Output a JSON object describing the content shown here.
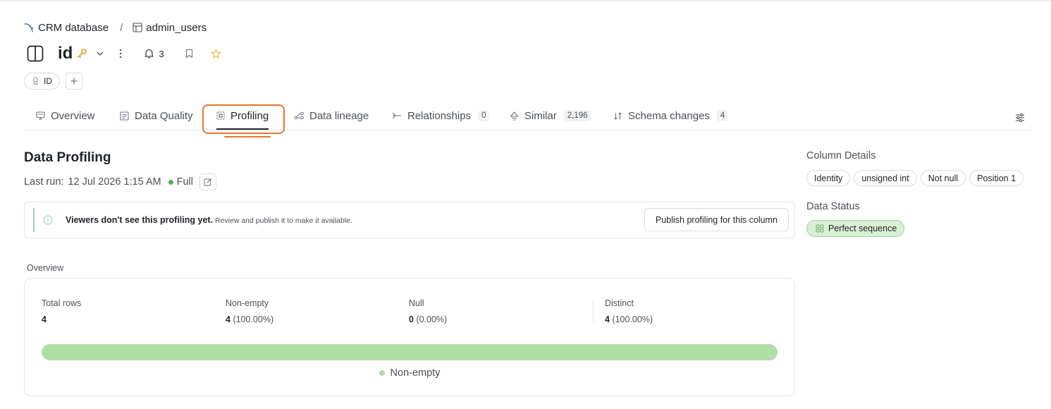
{
  "breadcrumb": {
    "database": "CRM database",
    "separator": "/",
    "table": "admin_users"
  },
  "header": {
    "title": "id",
    "notification_count": "3"
  },
  "tags": [
    {
      "label": "ID"
    }
  ],
  "tabs": [
    {
      "label": "Overview",
      "icon": "overview-icon"
    },
    {
      "label": "Data Quality",
      "icon": "data-quality-icon"
    },
    {
      "label": "Profiling",
      "icon": "profiling-icon",
      "active": true
    },
    {
      "label": "Data lineage",
      "icon": "lineage-icon"
    },
    {
      "label": "Relationships",
      "icon": "relationships-icon",
      "count": "0"
    },
    {
      "label": "Similar",
      "icon": "similar-icon",
      "count": "2,196"
    },
    {
      "label": "Schema changes",
      "icon": "schema-changes-icon",
      "count": "4"
    }
  ],
  "profiling": {
    "title": "Data Profiling",
    "last_run_label": "Last run:",
    "last_run_value": "12 Jul 2026 1:15 AM",
    "run_type": "Full",
    "notice_title": "Viewers don't see this profiling yet.",
    "notice_text": "Review and publish it to make it available.",
    "publish_label": "Publish profiling for this column"
  },
  "overview": {
    "label": "Overview",
    "stats": [
      {
        "label": "Total rows",
        "value": "4",
        "pct": ""
      },
      {
        "label": "Non-empty",
        "value": "4",
        "pct": "(100.00%)"
      },
      {
        "label": "Null",
        "value": "0",
        "pct": "(0.00%)"
      },
      {
        "label": "Distinct",
        "value": "4",
        "pct": "(100.00%)"
      }
    ],
    "non_empty_fraction": 1.0,
    "legend_label": "Non-empty"
  },
  "column_details": {
    "title": "Column Details",
    "chips": [
      "Identity",
      "unsigned int",
      "Not null",
      "Position 1"
    ]
  },
  "data_status": {
    "title": "Data Status",
    "value": "Perfect sequence"
  },
  "colors": {
    "annotation": "#e8762d",
    "key": "#e0a82e",
    "star": "#e8b93a",
    "success": "#4caf50",
    "progress_fill": "#b0dea6",
    "status_bg": "#d8f0d4"
  }
}
